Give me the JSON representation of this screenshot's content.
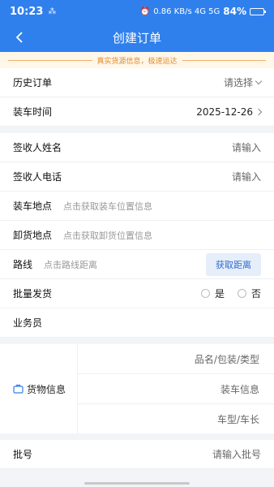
{
  "status_bar": {
    "time": "10:23",
    "notification": "⁂",
    "network": "0.86 KB/s  4G  5G",
    "battery": "84%",
    "battery_level": 0.84
  },
  "nav": {
    "title": "创建订单"
  },
  "notice": {
    "text": "真实货源信息，极速运达"
  },
  "rows": {
    "history": {
      "label": "历史订单",
      "value": "请选择"
    },
    "load_time": {
      "label": "装车时间",
      "value": "2025-12-26"
    },
    "receiver_name": {
      "label": "签收人姓名",
      "placeholder": "请输入"
    },
    "receiver_phone": {
      "label": "签收人电话",
      "placeholder": "请输入"
    },
    "load_place": {
      "label": "装车地点",
      "placeholder": "点击获取装车位置信息"
    },
    "unload_place": {
      "label": "卸货地点",
      "placeholder": "点击获取卸货位置信息"
    },
    "route": {
      "label": "路线",
      "placeholder": "点击路线距离",
      "button": "获取距离"
    },
    "batch": {
      "label": "批量发货",
      "option_yes": "是",
      "option_no": "否"
    },
    "salesman": {
      "label": "业务员"
    }
  },
  "cargo": {
    "label": "货物信息",
    "icon": "briefcase-icon",
    "items": [
      "品名/包装/类型",
      "装车信息",
      "车型/车长"
    ]
  },
  "batch_no": {
    "label": "批号",
    "placeholder": "请输入批号"
  },
  "colors": {
    "primary": "#2f80ed",
    "notice_text": "#e08a2e",
    "button_bg": "#e6eef9"
  }
}
